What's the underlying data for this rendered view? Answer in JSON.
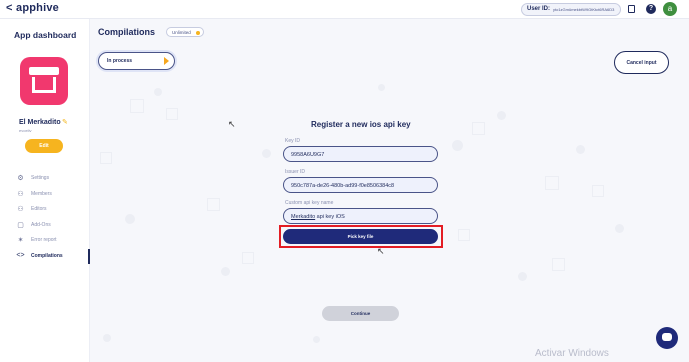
{
  "topbar": {
    "back_glyph": "<",
    "logo": "apphive",
    "user_id_label": "User ID:",
    "user_id_value": "yto1zGmümekbtW9GtKtct6RA6D3",
    "copy_icon": "copy-icon",
    "help_glyph": "?",
    "avatar_letter": "a"
  },
  "sidebar": {
    "title": "App dashboard",
    "app_name": "El Merkadito",
    "app_sub": "evoeliv",
    "edit_label": "Edit",
    "items": [
      {
        "label": "Settings",
        "icon": "gear-icon",
        "glyph": "⚙",
        "active": false
      },
      {
        "label": "Members",
        "icon": "members-icon",
        "glyph": "⚇",
        "active": false
      },
      {
        "label": "Editors",
        "icon": "editors-icon",
        "glyph": "⚇",
        "active": false
      },
      {
        "label": "Add-Ons",
        "icon": "addons-icon",
        "glyph": "▢",
        "active": false
      },
      {
        "label": "Error report",
        "icon": "bug-icon",
        "glyph": "✶",
        "active": false
      },
      {
        "label": "Compilations",
        "icon": "code-icon",
        "glyph": "<>",
        "active": true
      }
    ]
  },
  "header": {
    "title": "Compilations",
    "plan_badge": "Unlimited",
    "status_tab": "In process",
    "cancel_label": "Cancel input"
  },
  "form": {
    "title": "Register a new ios api key",
    "key_id_label": "Key ID",
    "key_id_value": "9958A6U9G7",
    "issuer_id_label": "Issuer ID",
    "issuer_id_value": "950c787a-de26-480b-ad99-f0e8506384c8",
    "custom_name_label": "Custom api key name",
    "custom_name_value_underlined": "Merkadito",
    "custom_name_value_rest": " api key iOS",
    "pick_key_label": "Pick key file",
    "continue_label": "Continue"
  },
  "watermark": "Activar Windows",
  "colors": {
    "primary": "#1f2a5c",
    "button_dark": "#1f2a7a",
    "accent": "#f6b41f",
    "app_icon": "#f1386e",
    "highlight": "#e31d24"
  }
}
